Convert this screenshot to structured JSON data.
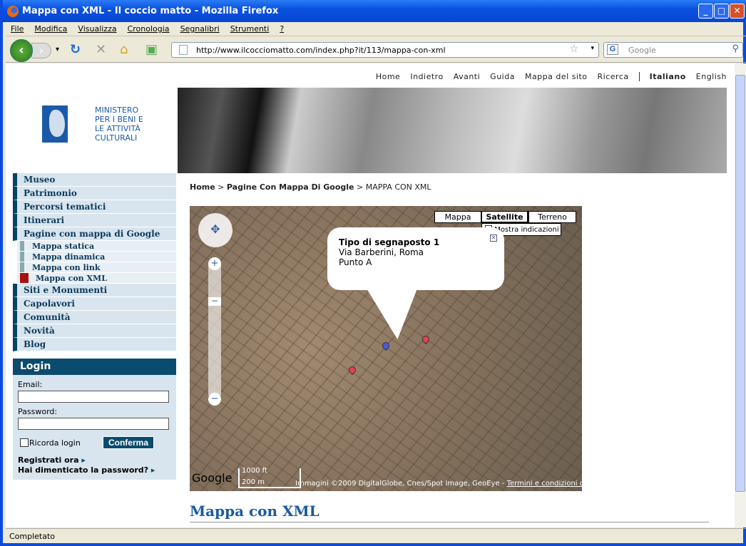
{
  "window": {
    "title": "Mappa con XML - Il coccio matto - Mozilla Firefox"
  },
  "menubar": [
    "File",
    "Modifica",
    "Visualizza",
    "Cronologia",
    "Segnalibri",
    "Strumenti",
    "?"
  ],
  "navbar": {
    "url": "http://www.ilcocciomatto.com/index.php?it/113/mappa-con-xml",
    "search_placeholder": "Google"
  },
  "toplinks": [
    "Home",
    "Indietro",
    "Avanti",
    "Guida",
    "Mappa del sito",
    "Ricerca"
  ],
  "languages": {
    "current": "Italiano",
    "other": "English"
  },
  "logo": {
    "text": "MINISTERO PER I BENI E LE ATTIVITÀ CULTURALI",
    "mark": "MiBAC"
  },
  "sidebar": {
    "items": [
      "Museo",
      "Patrimonio",
      "Percorsi tematici",
      "Itinerari",
      "Pagine con mappa di Google"
    ],
    "subitems": [
      "Mappa statica",
      "Mappa dinamica",
      "Mappa con link",
      "Mappa con XML"
    ],
    "items2": [
      "Siti e Monumenti",
      "Capolavori",
      "Comunità",
      "Novità",
      "Blog"
    ]
  },
  "login": {
    "title": "Login",
    "email_label": "Email:",
    "password_label": "Password:",
    "remember": "Ricorda login",
    "submit": "Conferma",
    "register": "Registrati ora",
    "forgot": "Hai dimenticato la password?"
  },
  "breadcrumb": {
    "home": "Home",
    "parent": "Pagine Con Mappa Di Google",
    "current": "MAPPA CON XML"
  },
  "map": {
    "types": [
      "Mappa",
      "Satellite",
      "Terreno"
    ],
    "active_type": "Satellite",
    "show_labels": "Mostra indicazioni",
    "info": {
      "title": "Tipo di segnaposto 1",
      "line1": "Via Barberini, Roma",
      "line2": "Punto A"
    },
    "scale_ft": "1000 ft",
    "scale_m": "200 m",
    "copyright": "Immagini ©2009 DigitalGlobe, Cnes/Spot Image, GeoEye -",
    "terms": "Termini e condizioni d'uso",
    "google": "Google"
  },
  "content": {
    "heading": "Mappa con XML"
  },
  "status": "Completato"
}
